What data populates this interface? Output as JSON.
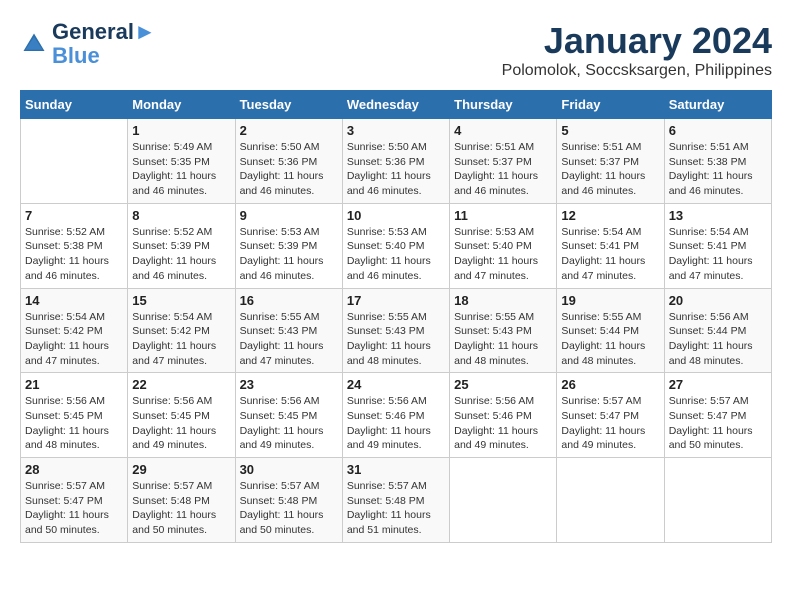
{
  "header": {
    "logo_line1": "General",
    "logo_line2": "Blue",
    "month": "January 2024",
    "location": "Polomolok, Soccsksargen, Philippines"
  },
  "weekdays": [
    "Sunday",
    "Monday",
    "Tuesday",
    "Wednesday",
    "Thursday",
    "Friday",
    "Saturday"
  ],
  "weeks": [
    [
      {
        "day": "",
        "info": ""
      },
      {
        "day": "1",
        "info": "Sunrise: 5:49 AM\nSunset: 5:35 PM\nDaylight: 11 hours\nand 46 minutes."
      },
      {
        "day": "2",
        "info": "Sunrise: 5:50 AM\nSunset: 5:36 PM\nDaylight: 11 hours\nand 46 minutes."
      },
      {
        "day": "3",
        "info": "Sunrise: 5:50 AM\nSunset: 5:36 PM\nDaylight: 11 hours\nand 46 minutes."
      },
      {
        "day": "4",
        "info": "Sunrise: 5:51 AM\nSunset: 5:37 PM\nDaylight: 11 hours\nand 46 minutes."
      },
      {
        "day": "5",
        "info": "Sunrise: 5:51 AM\nSunset: 5:37 PM\nDaylight: 11 hours\nand 46 minutes."
      },
      {
        "day": "6",
        "info": "Sunrise: 5:51 AM\nSunset: 5:38 PM\nDaylight: 11 hours\nand 46 minutes."
      }
    ],
    [
      {
        "day": "7",
        "info": "Sunrise: 5:52 AM\nSunset: 5:38 PM\nDaylight: 11 hours\nand 46 minutes."
      },
      {
        "day": "8",
        "info": "Sunrise: 5:52 AM\nSunset: 5:39 PM\nDaylight: 11 hours\nand 46 minutes."
      },
      {
        "day": "9",
        "info": "Sunrise: 5:53 AM\nSunset: 5:39 PM\nDaylight: 11 hours\nand 46 minutes."
      },
      {
        "day": "10",
        "info": "Sunrise: 5:53 AM\nSunset: 5:40 PM\nDaylight: 11 hours\nand 46 minutes."
      },
      {
        "day": "11",
        "info": "Sunrise: 5:53 AM\nSunset: 5:40 PM\nDaylight: 11 hours\nand 47 minutes."
      },
      {
        "day": "12",
        "info": "Sunrise: 5:54 AM\nSunset: 5:41 PM\nDaylight: 11 hours\nand 47 minutes."
      },
      {
        "day": "13",
        "info": "Sunrise: 5:54 AM\nSunset: 5:41 PM\nDaylight: 11 hours\nand 47 minutes."
      }
    ],
    [
      {
        "day": "14",
        "info": "Sunrise: 5:54 AM\nSunset: 5:42 PM\nDaylight: 11 hours\nand 47 minutes."
      },
      {
        "day": "15",
        "info": "Sunrise: 5:54 AM\nSunset: 5:42 PM\nDaylight: 11 hours\nand 47 minutes."
      },
      {
        "day": "16",
        "info": "Sunrise: 5:55 AM\nSunset: 5:43 PM\nDaylight: 11 hours\nand 47 minutes."
      },
      {
        "day": "17",
        "info": "Sunrise: 5:55 AM\nSunset: 5:43 PM\nDaylight: 11 hours\nand 48 minutes."
      },
      {
        "day": "18",
        "info": "Sunrise: 5:55 AM\nSunset: 5:43 PM\nDaylight: 11 hours\nand 48 minutes."
      },
      {
        "day": "19",
        "info": "Sunrise: 5:55 AM\nSunset: 5:44 PM\nDaylight: 11 hours\nand 48 minutes."
      },
      {
        "day": "20",
        "info": "Sunrise: 5:56 AM\nSunset: 5:44 PM\nDaylight: 11 hours\nand 48 minutes."
      }
    ],
    [
      {
        "day": "21",
        "info": "Sunrise: 5:56 AM\nSunset: 5:45 PM\nDaylight: 11 hours\nand 48 minutes."
      },
      {
        "day": "22",
        "info": "Sunrise: 5:56 AM\nSunset: 5:45 PM\nDaylight: 11 hours\nand 49 minutes."
      },
      {
        "day": "23",
        "info": "Sunrise: 5:56 AM\nSunset: 5:45 PM\nDaylight: 11 hours\nand 49 minutes."
      },
      {
        "day": "24",
        "info": "Sunrise: 5:56 AM\nSunset: 5:46 PM\nDaylight: 11 hours\nand 49 minutes."
      },
      {
        "day": "25",
        "info": "Sunrise: 5:56 AM\nSunset: 5:46 PM\nDaylight: 11 hours\nand 49 minutes."
      },
      {
        "day": "26",
        "info": "Sunrise: 5:57 AM\nSunset: 5:47 PM\nDaylight: 11 hours\nand 49 minutes."
      },
      {
        "day": "27",
        "info": "Sunrise: 5:57 AM\nSunset: 5:47 PM\nDaylight: 11 hours\nand 50 minutes."
      }
    ],
    [
      {
        "day": "28",
        "info": "Sunrise: 5:57 AM\nSunset: 5:47 PM\nDaylight: 11 hours\nand 50 minutes."
      },
      {
        "day": "29",
        "info": "Sunrise: 5:57 AM\nSunset: 5:48 PM\nDaylight: 11 hours\nand 50 minutes."
      },
      {
        "day": "30",
        "info": "Sunrise: 5:57 AM\nSunset: 5:48 PM\nDaylight: 11 hours\nand 50 minutes."
      },
      {
        "day": "31",
        "info": "Sunrise: 5:57 AM\nSunset: 5:48 PM\nDaylight: 11 hours\nand 51 minutes."
      },
      {
        "day": "",
        "info": ""
      },
      {
        "day": "",
        "info": ""
      },
      {
        "day": "",
        "info": ""
      }
    ]
  ]
}
